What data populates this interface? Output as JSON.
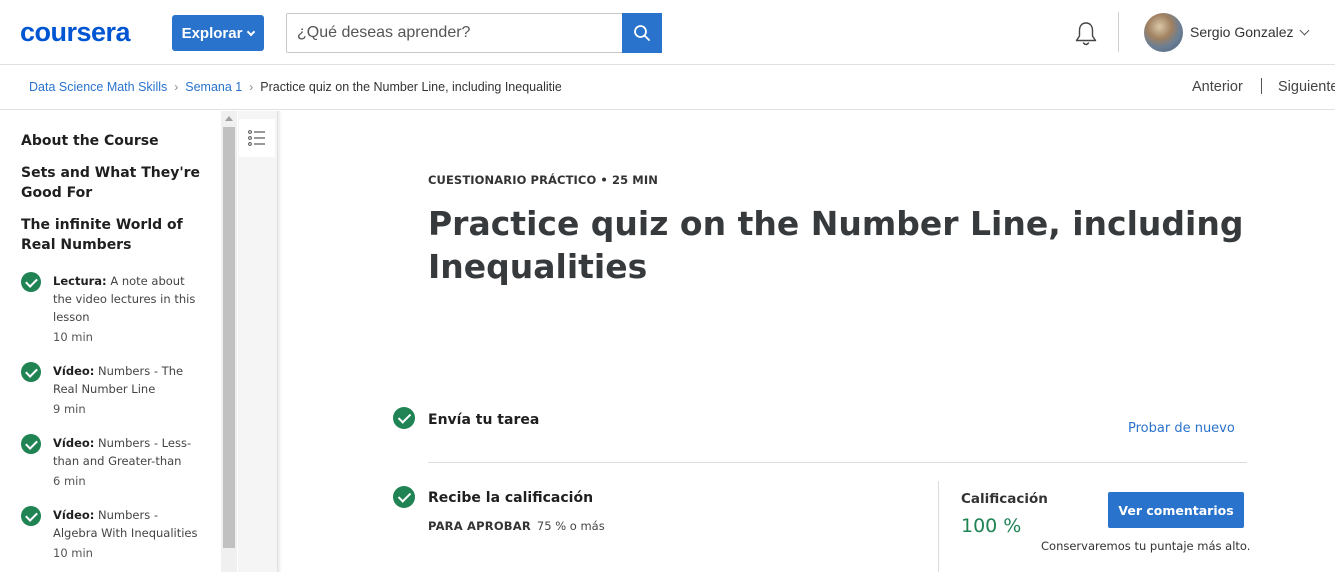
{
  "header": {
    "logo": "coursera",
    "explore_label": "Explorar",
    "search_placeholder": "¿Qué deseas aprender?",
    "user_name": "Sergio Gonzalez"
  },
  "breadcrumb": {
    "items": [
      "Data Science Math Skills",
      "Semana 1"
    ],
    "current": "Practice quiz on the Number Line, including Inequalities",
    "prev_label": "Anterior",
    "next_label": "Siguiente"
  },
  "sidebar": {
    "sections": [
      "About the Course",
      "Sets and What They're Good For",
      "The infinite World of Real Numbers"
    ],
    "lessons": [
      {
        "type": "Lectura:",
        "title": "A note about the video lectures in this lesson",
        "duration": "10 min"
      },
      {
        "type": "Vídeo:",
        "title": "Numbers - The Real Number Line",
        "duration": "9 min"
      },
      {
        "type": "Vídeo:",
        "title": "Numbers - Less-than and Greater-than",
        "duration": "6 min"
      },
      {
        "type": "Vídeo:",
        "title": "Numbers - Algebra With Inequalities",
        "duration": "10 min"
      }
    ]
  },
  "main": {
    "eyebrow": "CUESTIONARIO PRÁCTICO • 25 MIN",
    "title": "Practice quiz on the Number Line, including Inequalities",
    "submit_step": {
      "title": "Envía tu tarea",
      "retry_label": "Probar de nuevo"
    },
    "grade_step": {
      "title": "Recibe la calificación",
      "pass_label": "PARA APROBAR",
      "pass_value": "75 % o más",
      "grade_label": "Calificación",
      "grade_value": "100 %",
      "feedback_button": "Ver comentarios",
      "keep_note": "Conservaremos tu puntaje más alto."
    }
  },
  "colors": {
    "brand_blue": "#0056d2",
    "button_blue": "#2a73cc",
    "success_green": "#1f8354"
  }
}
